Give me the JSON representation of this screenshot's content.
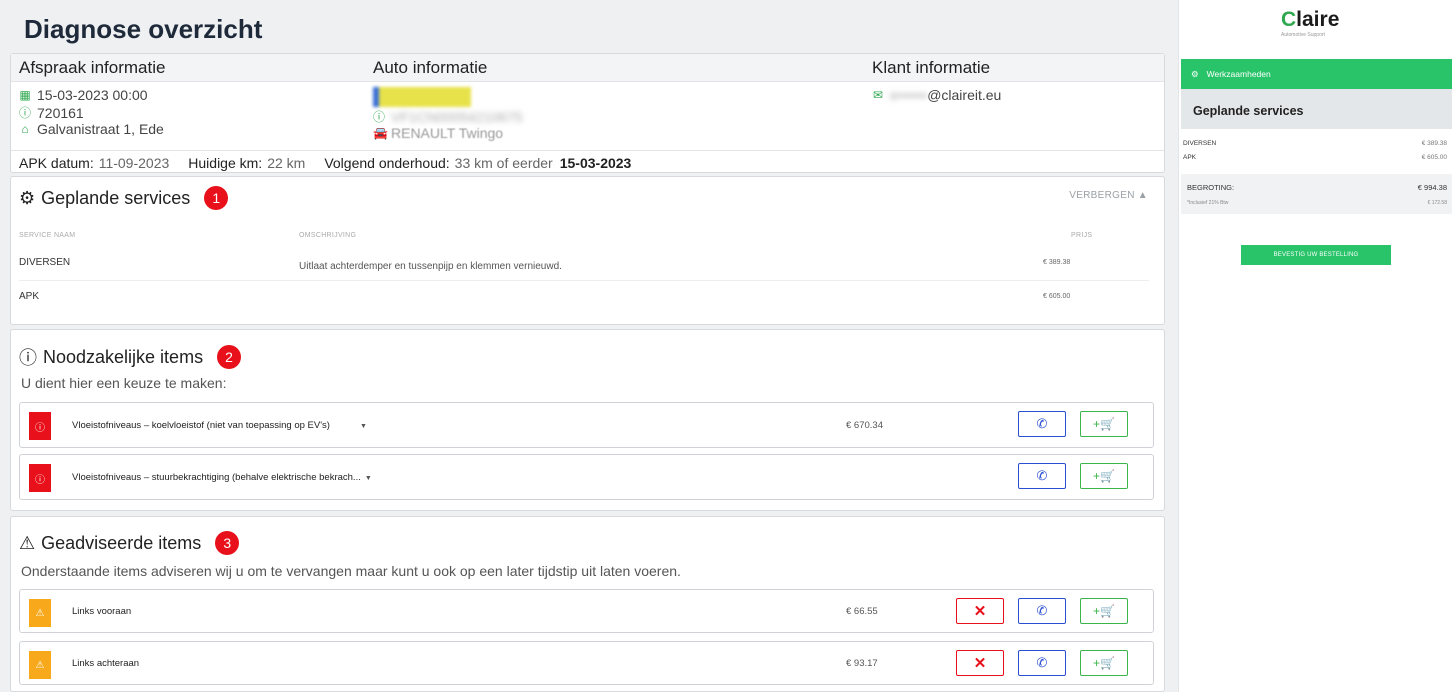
{
  "page": {
    "title": "Diagnose overzicht"
  },
  "info": {
    "afspraak_title": "Afspraak informatie",
    "auto_title": "Auto informatie",
    "klant_title": "Klant informatie",
    "date": "15-03-2023 00:00",
    "order_number": "720161",
    "address": "Galvanistraat 1, Ede",
    "plate": "",
    "vin": "VF1CN00054210675",
    "car_model": "RENAULT Twingo",
    "email_hidden": "e••••••",
    "email_domain": "@claireit.eu",
    "apk_label": "APK datum:",
    "apk_value": "11-09-2023",
    "km_label": "Huidige km:",
    "km_value": "22 km",
    "onderhoud_label": "Volgend onderhoud:",
    "onderhoud_value": "33 km of eerder",
    "onderhoud_date": "15-03-2023"
  },
  "services": {
    "title": "Geplande services",
    "badge": "1",
    "hide_label": "VERBERGEN ▲",
    "col_name": "SERVICE NAAM",
    "col_desc": "OMSCHRIJVING",
    "col_price": "PRIJS",
    "rows": [
      {
        "name": "DIVERSEN",
        "desc": "Uitlaat achterdemper en tussenpijp en klemmen vernieuwd.",
        "price": "€ 389.38"
      },
      {
        "name": "APK",
        "desc": "",
        "price": "€ 605.00"
      }
    ]
  },
  "noodzakelijk": {
    "title": "Noodzakelijke items",
    "badge": "2",
    "subtitle": "U dient hier een keuze te maken:",
    "items": [
      {
        "label": "Vloeistofniveaus – koelvloeistof (niet van toepassing op EV's)",
        "price": "€ 670.34"
      },
      {
        "label": "Vloeistofniveaus – stuurbekrachtiging (behalve elektrische bekrach...",
        "price": ""
      }
    ]
  },
  "geadviseerd": {
    "title": "Geadviseerde items",
    "badge": "3",
    "subtitle": "Onderstaande items adviseren wij u om te vervangen maar kunt u ook op een later tijdstip uit laten voeren.",
    "items": [
      {
        "label": "Links vooraan",
        "price": "€ 66.55"
      },
      {
        "label": "Links achteraan",
        "price": "€ 93.17"
      }
    ]
  },
  "sidebar": {
    "logo_c": "C",
    "logo_rest": "laire",
    "logo_sub": "Automotive Support",
    "tab_label": "Werkzaamheden",
    "section_title": "Geplande services",
    "rows": [
      {
        "name": "DIVERSEN",
        "price": "€ 389.38"
      },
      {
        "name": "APK",
        "price": "€ 605.00"
      }
    ],
    "total_label": "BEGROTING:",
    "total_value": "€ 994.38",
    "vat_label": "*Inclusief 21% Btw",
    "vat_value": "€ 172.58",
    "confirm_label": "BEVESTIG UW BESTELLING"
  },
  "icons": {
    "calendar": "calendar-icon",
    "info": "info-icon",
    "location": "location-icon",
    "car": "car-icon",
    "mail": "mail-icon",
    "gear": "gear-icon",
    "alert_circle": "alert-circle-icon",
    "warning": "warning-icon",
    "phone": "phone-icon",
    "cart": "cart-icon",
    "close": "close-icon"
  },
  "colors": {
    "accent": "#29c46a",
    "danger": "#e8101a",
    "warning": "#f7a81b",
    "phone": "#2b4fd1",
    "cart": "#3bb54a"
  }
}
